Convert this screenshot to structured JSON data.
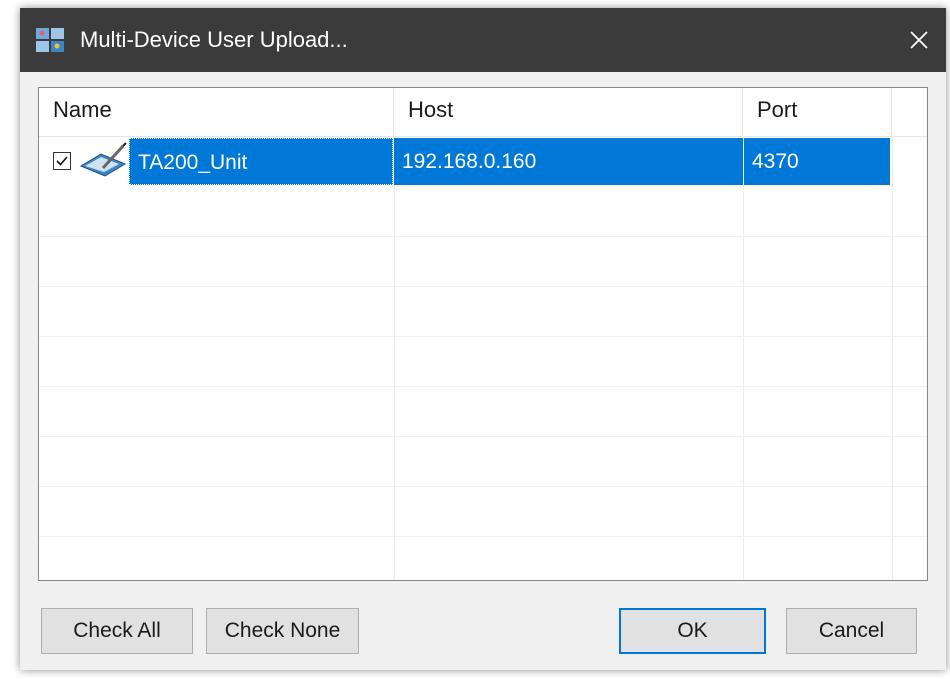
{
  "window": {
    "title": "Multi-Device User Upload...",
    "close_glyph": "✕"
  },
  "list": {
    "columns": [
      "Name",
      "Host",
      "Port"
    ],
    "rows": [
      {
        "checked": true,
        "icon": "device-pen-icon",
        "name": "TA200_Unit",
        "host": "192.168.0.160",
        "port": "4370",
        "selected": true
      }
    ],
    "selection_color": "#0078d7"
  },
  "buttons": {
    "check_all": "Check All",
    "check_none": "Check None",
    "ok": "OK",
    "cancel": "Cancel"
  },
  "colors": {
    "titlebar": "#3b3b3b",
    "dialog_bg": "#f0f0f0",
    "accent": "#0078d7"
  }
}
